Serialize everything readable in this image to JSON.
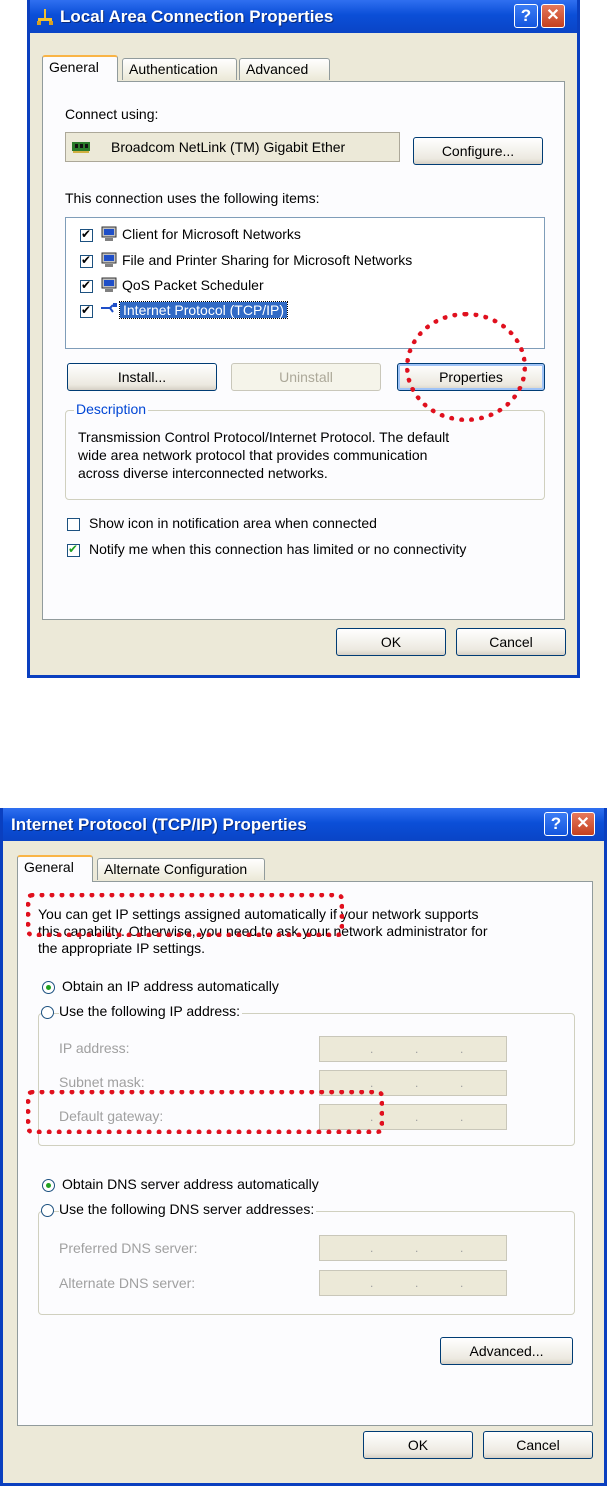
{
  "dialog1": {
    "title": "Local Area Connection Properties",
    "help_button": "?",
    "close_button": "✕",
    "tabs": [
      "General",
      "Authentication",
      "Advanced"
    ],
    "connect_using_label": "Connect using:",
    "adapter_name": "Broadcom NetLink (TM) Gigabit Ether",
    "configure_button": "Configure...",
    "items_label": "This connection uses the following items:",
    "items": [
      {
        "label": "Client for Microsoft Networks",
        "checked": true,
        "icon": "network-client-icon"
      },
      {
        "label": "File and Printer Sharing for Microsoft Networks",
        "checked": true,
        "icon": "file-sharing-icon"
      },
      {
        "label": "QoS Packet Scheduler",
        "checked": true,
        "icon": "scheduler-icon"
      },
      {
        "label": "Internet Protocol (TCP/IP)",
        "checked": true,
        "selected": true,
        "icon": "protocol-icon"
      }
    ],
    "install_button": "Install...",
    "uninstall_button": "Uninstall",
    "properties_button": "Properties",
    "description_title": "Description",
    "description_lines": [
      "Transmission Control Protocol/Internet Protocol. The default",
      "wide area network protocol that provides communication",
      "across diverse interconnected networks."
    ],
    "show_icon_label": "Show icon in notification area when connected",
    "notify_label": "Notify me when this connection has limited or no connectivity",
    "ok_button": "OK",
    "cancel_button": "Cancel"
  },
  "dialog2": {
    "title": "Internet Protocol (TCP/IP) Properties",
    "help_button": "?",
    "close_button": "✕",
    "tabs": [
      "General",
      "Alternate Configuration"
    ],
    "intro_lines": [
      "You can get IP settings assigned automatically if your network supports",
      "this capability. Otherwise, you need to ask your network administrator for",
      "the appropriate IP settings."
    ],
    "obtain_ip_label": "Obtain an IP address automatically",
    "use_ip_label": "Use the following IP address:",
    "ip_address_label": "IP address:",
    "subnet_mask_label": "Subnet mask:",
    "default_gateway_label": "Default gateway:",
    "obtain_dns_label": "Obtain DNS server address automatically",
    "use_dns_label": "Use the following DNS server addresses:",
    "preferred_dns_label": "Preferred DNS server:",
    "alternate_dns_label": "Alternate DNS server:",
    "ip_dot": ".",
    "advanced_button": "Advanced...",
    "ok_button": "OK",
    "cancel_button": "Cancel"
  },
  "colors": {
    "annotation": "#e0101e",
    "title_bar": "#0b4fd8",
    "dialog_bg": "#ece9d8"
  }
}
